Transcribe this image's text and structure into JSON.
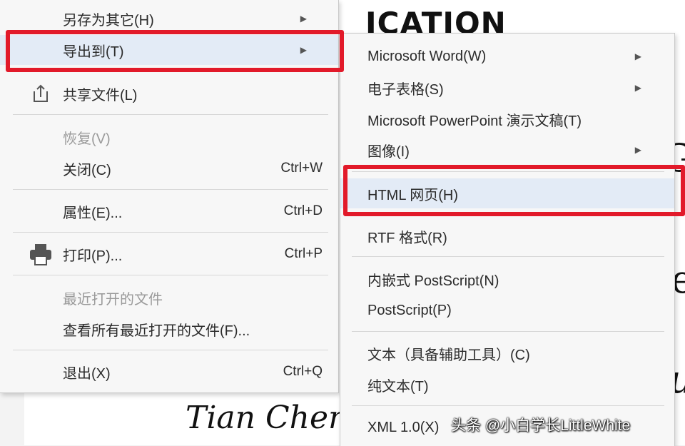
{
  "document": {
    "heading": "ICATION",
    "author": "Tian Chen, G",
    "edge_chars": [
      "G",
      "e",
      "u"
    ]
  },
  "main_menu": {
    "items": [
      {
        "label": "另存为其它(H)",
        "submenu": true
      },
      {
        "label": "导出到(T)",
        "submenu": true
      },
      {
        "label": "共享文件(L)",
        "icon": "share-icon"
      },
      {
        "label": "恢复(V)",
        "disabled": true
      },
      {
        "label": "关闭(C)",
        "shortcut": "Ctrl+W"
      },
      {
        "label": "属性(E)...",
        "shortcut": "Ctrl+D"
      },
      {
        "label": "打印(P)...",
        "shortcut": "Ctrl+P",
        "icon": "printer-icon"
      },
      {
        "label": "最近打开的文件",
        "disabled": true
      },
      {
        "label": "查看所有最近打开的文件(F)..."
      },
      {
        "label": "退出(X)",
        "shortcut": "Ctrl+Q"
      }
    ]
  },
  "sub_menu": {
    "items": [
      {
        "label": "Microsoft Word(W)",
        "submenu": true
      },
      {
        "label": "电子表格(S)",
        "submenu": true
      },
      {
        "label": "Microsoft PowerPoint 演示文稿(T)"
      },
      {
        "label": "图像(I)",
        "submenu": true
      },
      {
        "label": "HTML 网页(H)"
      },
      {
        "label": "RTF 格式(R)"
      },
      {
        "label": "内嵌式 PostScript(N)"
      },
      {
        "label": "PostScript(P)"
      },
      {
        "label": "文本（具备辅助工具）(C)"
      },
      {
        "label": "纯文本(T)"
      },
      {
        "label": "XML 1.0(X)"
      }
    ]
  },
  "watermark": "头条 @小白学长LittleWhite",
  "colors": {
    "highlight_box": "#e21a2a",
    "hover_bg": "#e3ebf6",
    "menu_bg": "#f7f7f7"
  }
}
